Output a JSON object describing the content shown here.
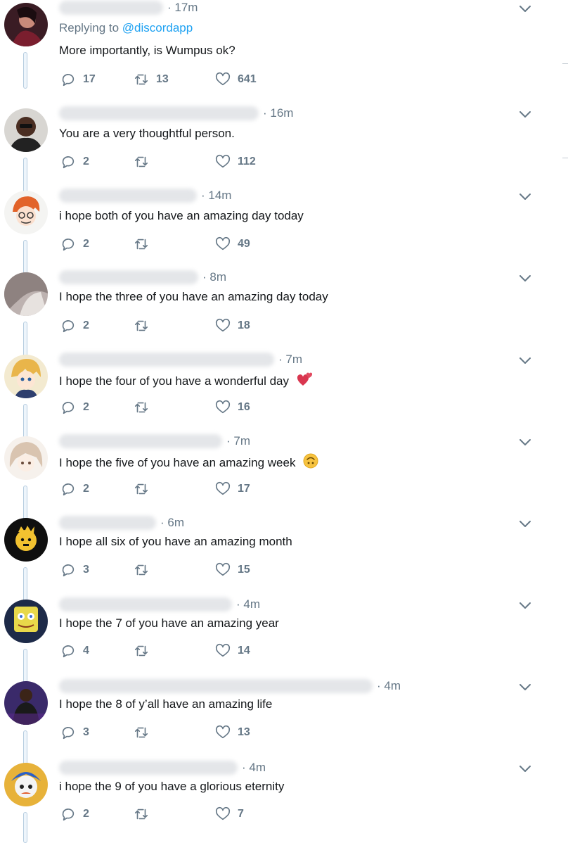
{
  "thread": {
    "replying_prefix": "Replying to",
    "replying_handle": "@discordapp",
    "tweets": [
      {
        "time": "· 17m",
        "text": "More importantly, is Wumpus ok?",
        "replies": "17",
        "retweets": "13",
        "likes": "641"
      },
      {
        "time": "· 16m",
        "text": "You are a very thoughtful person.",
        "replies": "2",
        "retweets": "",
        "likes": "112"
      },
      {
        "time": "· 14m",
        "text": "i hope both of you have an amazing day today",
        "replies": "2",
        "retweets": "",
        "likes": "49"
      },
      {
        "time": "· 8m",
        "text": "I hope the three of you have an amazing day today",
        "replies": "2",
        "retweets": "",
        "likes": "18"
      },
      {
        "time": "· 7m",
        "text": "I hope the four of you have a wonderful day",
        "replies": "2",
        "retweets": "",
        "likes": "16"
      },
      {
        "time": "· 7m",
        "text": "I hope the five of you have an amazing week",
        "replies": "2",
        "retweets": "",
        "likes": "17"
      },
      {
        "time": "· 6m",
        "text": "I hope all six of you have an amazing month",
        "replies": "3",
        "retweets": "",
        "likes": "15"
      },
      {
        "time": "· 4m",
        "text": "I hope the 7 of you have an amazing year",
        "replies": "4",
        "retweets": "",
        "likes": "14"
      },
      {
        "time": "· 4m",
        "text": "I hope the 8 of y’all have an amazing life",
        "replies": "3",
        "retweets": "",
        "likes": "13"
      },
      {
        "time": "· 4m",
        "text": "i hope the 9 of you have a glorious eternity",
        "replies": "2",
        "retweets": "",
        "likes": "7"
      }
    ]
  },
  "icons": {
    "reply": "reply-icon",
    "retweet": "retweet-icon",
    "like": "heart-icon",
    "menu": "chevron-down-icon",
    "emoji_4": "two-hearts-emoji",
    "emoji_5": "upside-down-face-emoji"
  },
  "colors": {
    "text": "#14171a",
    "muted": "#657786",
    "link": "#1da1f2",
    "thread_line": "#b7cde0"
  }
}
